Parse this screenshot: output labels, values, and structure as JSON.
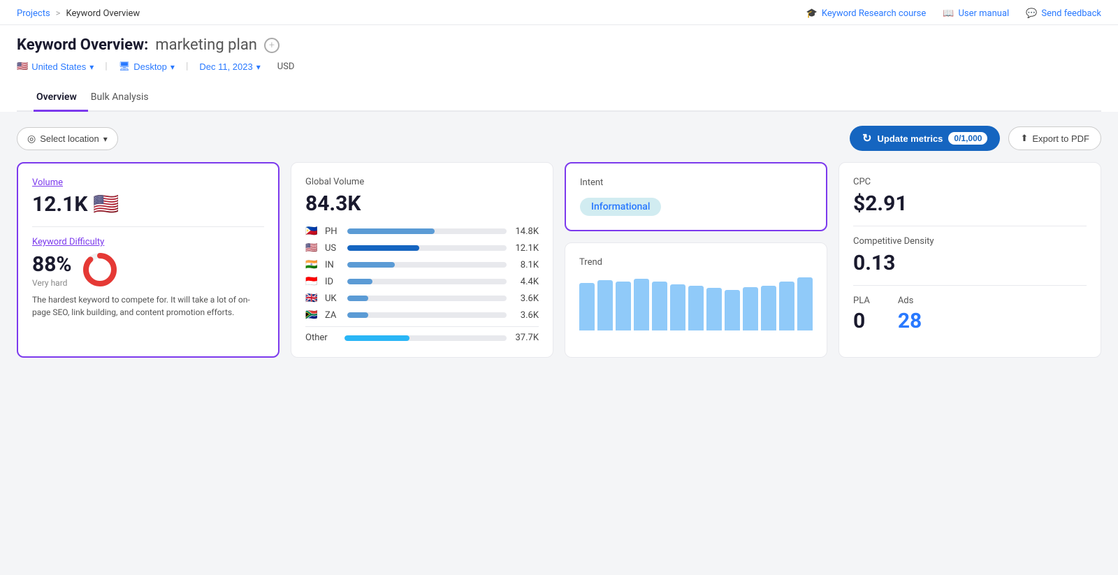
{
  "breadcrumb": {
    "projects": "Projects",
    "sep": ">",
    "current": "Keyword Overview"
  },
  "topnav": {
    "course_icon": "🎓",
    "course_label": "Keyword Research course",
    "manual_icon": "📖",
    "manual_label": "User manual",
    "feedback_icon": "💬",
    "feedback_label": "Send feedback"
  },
  "page": {
    "title_prefix": "Keyword Overview:",
    "keyword": "marketing plan",
    "add_tooltip": "+"
  },
  "filters": {
    "country_flag": "🇺🇸",
    "country": "United States",
    "device": "Desktop",
    "date": "Dec 11, 2023",
    "currency": "USD"
  },
  "tabs": [
    {
      "id": "overview",
      "label": "Overview",
      "active": true
    },
    {
      "id": "bulk",
      "label": "Bulk Analysis",
      "active": false
    }
  ],
  "controls": {
    "select_location": "Select location",
    "update_metrics": "Update metrics",
    "metrics_count": "0/1,000",
    "export": "Export to PDF"
  },
  "volume_card": {
    "label": "Volume",
    "value": "12.1K",
    "flag": "🇺🇸",
    "kd_label": "Keyword Difficulty",
    "kd_value": "88%",
    "kd_difficulty": "Very hard",
    "kd_donut_pct": 88,
    "kd_desc": "The hardest keyword to compete for. It will take a lot of on-page SEO, link building, and content promotion efforts."
  },
  "global_volume_card": {
    "label": "Global Volume",
    "value": "84.3K",
    "countries": [
      {
        "flag": "🇵🇭",
        "code": "PH",
        "val": "14.8K",
        "pct": 55,
        "dark": false
      },
      {
        "flag": "🇺🇸",
        "code": "US",
        "val": "12.1K",
        "pct": 45,
        "dark": true
      },
      {
        "flag": "🇮🇳",
        "code": "IN",
        "val": "8.1K",
        "pct": 30,
        "dark": false
      },
      {
        "flag": "🇮🇩",
        "code": "ID",
        "val": "4.4K",
        "pct": 16,
        "dark": false
      },
      {
        "flag": "🇬🇧",
        "code": "UK",
        "val": "3.6K",
        "pct": 13,
        "dark": false
      },
      {
        "flag": "🇿🇦",
        "code": "ZA",
        "val": "3.6K",
        "pct": 13,
        "dark": false
      }
    ],
    "other_label": "Other",
    "other_val": "37.7K",
    "other_pct": 40
  },
  "intent_card": {
    "label": "Intent",
    "badge": "Informational"
  },
  "trend_card": {
    "label": "Trend",
    "bars": [
      85,
      90,
      88,
      92,
      87,
      83,
      80,
      76,
      72,
      78,
      80,
      88,
      95
    ]
  },
  "right_card": {
    "cpc_label": "CPC",
    "cpc_value": "$2.91",
    "cd_label": "Competitive Density",
    "cd_value": "0.13",
    "pla_label": "PLA",
    "pla_value": "0",
    "ads_label": "Ads",
    "ads_value": "28"
  }
}
